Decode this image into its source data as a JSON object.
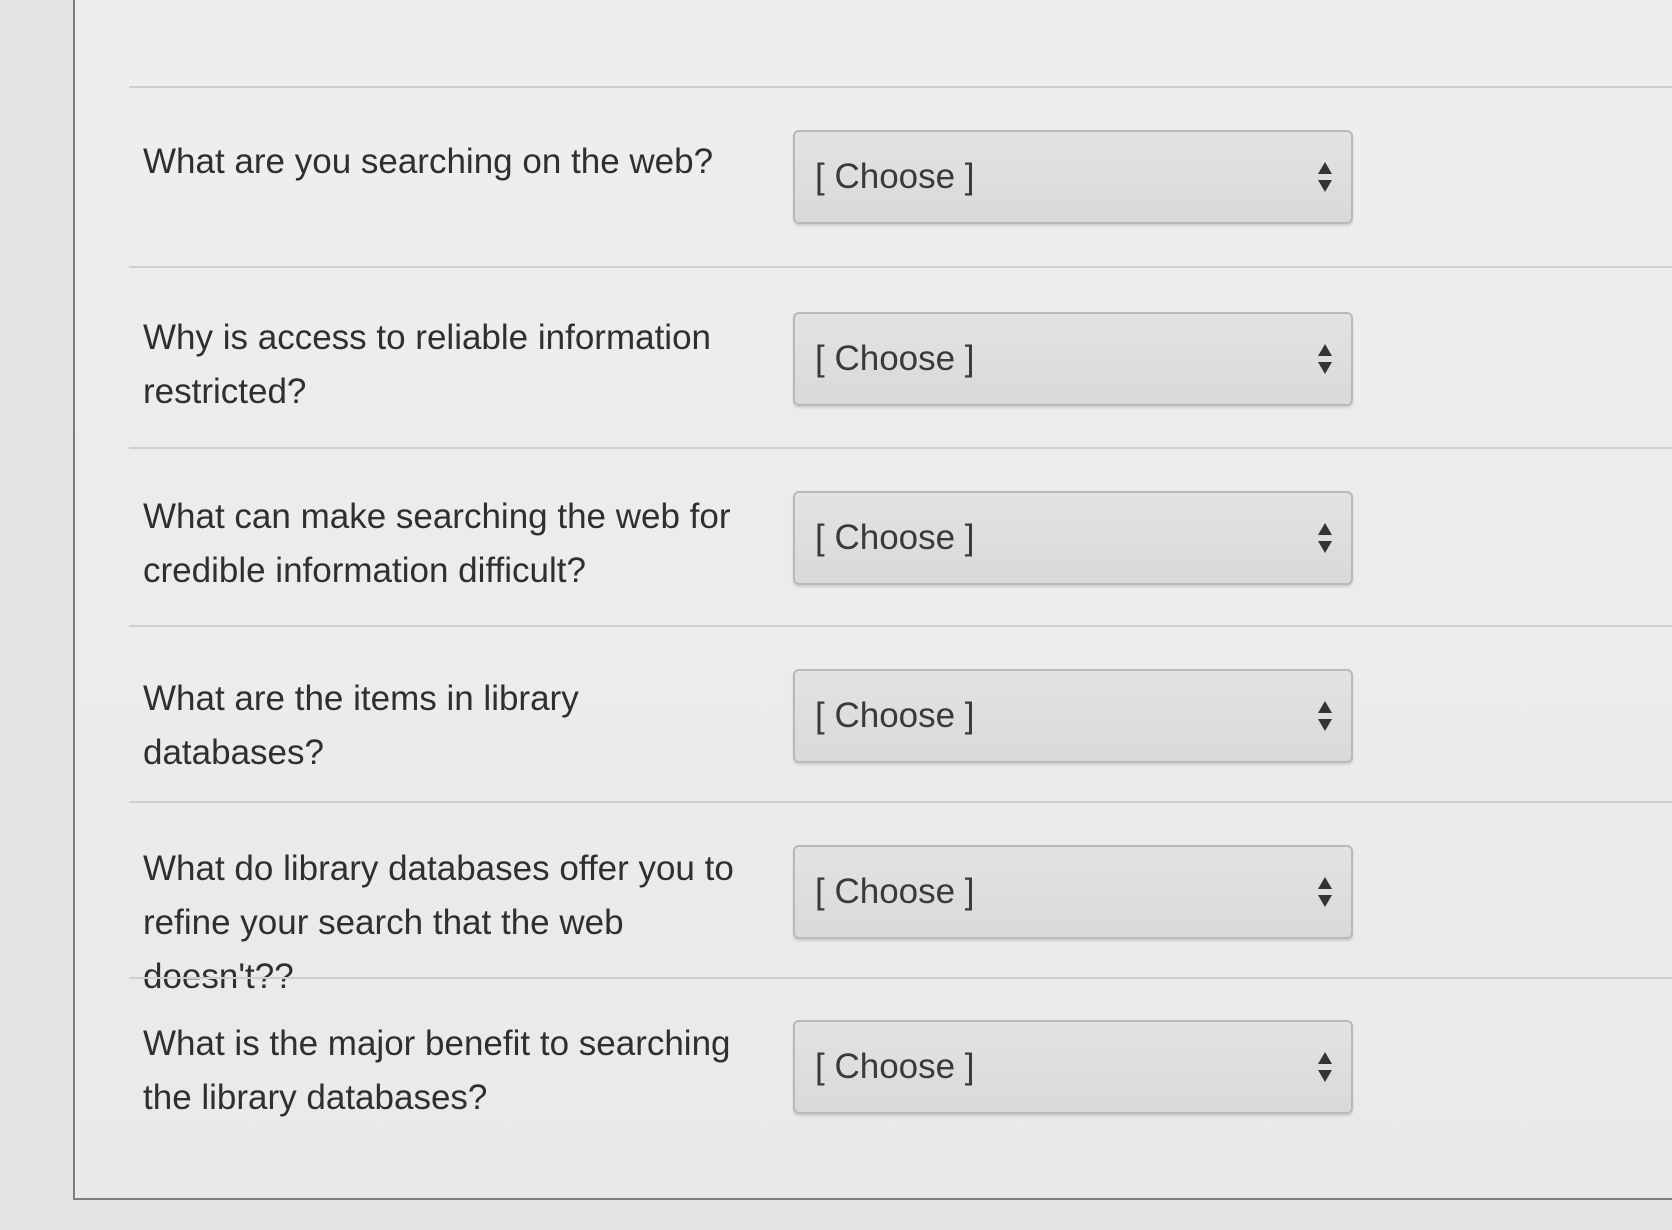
{
  "questions": [
    {
      "label": "What are you searching on the web?",
      "value": "[ Choose ]"
    },
    {
      "label": "Why is access to reliable information restricted?",
      "value": "[ Choose ]"
    },
    {
      "label": "What can make searching the web for credible information difficult?",
      "value": "[ Choose ]"
    },
    {
      "label": "What are the items in library databases?",
      "value": "[ Choose ]"
    },
    {
      "label": "What do library databases offer you to refine your search that the web doesn't??",
      "value": "[ Choose ]"
    },
    {
      "label": "What is the major benefit to searching the library databases?",
      "value": "[ Choose ]"
    }
  ],
  "icons": {
    "select_arrow": "up-down-arrows-icon"
  },
  "colors": {
    "text": "#2f2f2f",
    "select_bg": "#dcdcda",
    "panel_bg": "#ececea"
  }
}
